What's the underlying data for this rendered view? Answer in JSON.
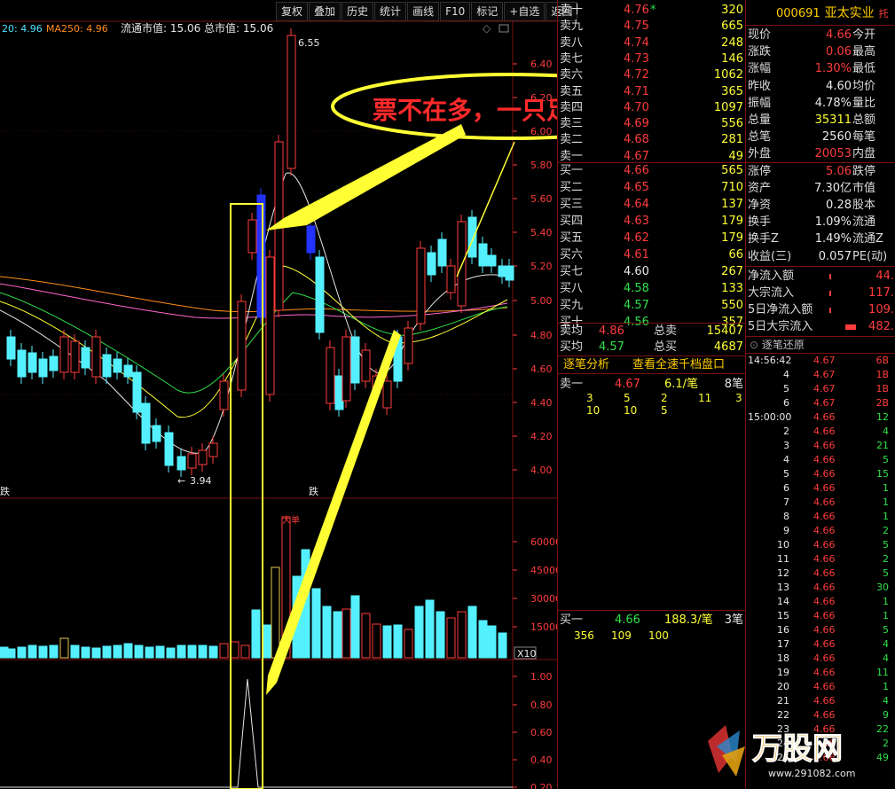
{
  "toolbar": {
    "buttons": [
      "复权",
      "叠加",
      "历史",
      "统计",
      "画线",
      "F10",
      "标记",
      "+自选",
      "返回"
    ]
  },
  "chart": {
    "ma_info": [
      {
        "text": "20: 4.96",
        "color": "#4fe2ff"
      },
      {
        "text": "MA250: 4.96",
        "color": "#ff8c1a"
      }
    ],
    "market_cap": "流通市值: 15.06 总市值: 15.06",
    "high_label": "6.55",
    "low_label": "3.94",
    "die_label_1": "跌",
    "die_label_2": "跌",
    "vol_marker": "大单",
    "annotation": "票不在多，一只足矣!",
    "price_axis": [
      "6.40",
      "6.20",
      "6.00",
      "5.80",
      "5.60",
      "5.40",
      "5.20",
      "5.00",
      "4.80",
      "4.60",
      "4.40",
      "4.20",
      "4.00"
    ],
    "vol_axis": [
      "60000",
      "45000",
      "30000",
      "15000"
    ],
    "vol_unit": "X10",
    "ind_axis": [
      "1.00",
      "0.80",
      "0.60",
      "0.40",
      "0.20"
    ]
  },
  "quote": {
    "sell": [
      {
        "name": "卖十",
        "price": "4.76",
        "vol": "320",
        "color": "#ff3c3c",
        "flag": "*"
      },
      {
        "name": "卖九",
        "price": "4.75",
        "vol": "665",
        "color": "#ff3c3c",
        "flag": ""
      },
      {
        "name": "卖八",
        "price": "4.74",
        "vol": "248",
        "color": "#ff3c3c",
        "flag": ""
      },
      {
        "name": "卖七",
        "price": "4.73",
        "vol": "146",
        "color": "#ff3c3c",
        "flag": ""
      },
      {
        "name": "卖六",
        "price": "4.72",
        "vol": "1062",
        "color": "#ff3c3c",
        "flag": ""
      },
      {
        "name": "卖五",
        "price": "4.71",
        "vol": "365",
        "color": "#ff3c3c",
        "flag": ""
      },
      {
        "name": "卖四",
        "price": "4.70",
        "vol": "1097",
        "color": "#ff3c3c",
        "flag": ""
      },
      {
        "name": "卖三",
        "price": "4.69",
        "vol": "556",
        "color": "#ff3c3c",
        "flag": ""
      },
      {
        "name": "卖二",
        "price": "4.68",
        "vol": "281",
        "color": "#ff3c3c",
        "flag": ""
      },
      {
        "name": "卖一",
        "price": "4.67",
        "vol": "49",
        "color": "#ff3c3c",
        "flag": ""
      }
    ],
    "buy": [
      {
        "name": "买一",
        "price": "4.66",
        "vol": "565",
        "color": "#ff3c3c"
      },
      {
        "name": "买二",
        "price": "4.65",
        "vol": "710",
        "color": "#ff3c3c"
      },
      {
        "name": "买三",
        "price": "4.64",
        "vol": "137",
        "color": "#ff3c3c"
      },
      {
        "name": "买四",
        "price": "4.63",
        "vol": "179",
        "color": "#ff3c3c"
      },
      {
        "name": "买五",
        "price": "4.62",
        "vol": "179",
        "color": "#ff3c3c"
      },
      {
        "name": "买六",
        "price": "4.61",
        "vol": "66",
        "color": "#ff3c3c"
      },
      {
        "name": "买七",
        "price": "4.60",
        "vol": "267",
        "color": "#e8e8e8"
      },
      {
        "name": "买八",
        "price": "4.58",
        "vol": "133",
        "color": "#2fe04a"
      },
      {
        "name": "买九",
        "price": "4.57",
        "vol": "550",
        "color": "#2fe04a"
      },
      {
        "name": "买十",
        "price": "4.56",
        "vol": "357",
        "color": "#2fe04a"
      }
    ],
    "avg_sell_label": "卖均",
    "avg_sell": "4.86",
    "total_sell_label": "总卖",
    "total_sell": "15407",
    "avg_buy_label": "买均",
    "avg_buy": "4.57",
    "total_buy_label": "总买",
    "total_buy": "4687",
    "tab_analysis": "逐笔分析",
    "tab_all": "查看全速千档盘口",
    "sell1": {
      "label": "卖一",
      "price": "4.67",
      "size": "6.1/笔",
      "count": "8笔",
      "orders": [
        [
          "3",
          "5",
          "2",
          "11",
          "3"
        ],
        [
          "10",
          "10",
          "5",
          "",
          ""
        ]
      ]
    },
    "buy1": {
      "label": "买一",
      "price": "4.66",
      "size": "188.3/笔",
      "count": "3笔",
      "orders": [
        [
          "356",
          "109",
          "100"
        ]
      ]
    }
  },
  "stock": {
    "code": "000691",
    "name": "亚太实业",
    "tag": "托",
    "stats": [
      [
        "现价",
        "4.66",
        "#ff3c3c",
        "今开",
        ""
      ],
      [
        "涨跌",
        "0.06",
        "#ff3c3c",
        "最高",
        ""
      ],
      [
        "涨幅",
        "1.30%",
        "#ff3c3c",
        "最低",
        ""
      ],
      [
        "昨收",
        "4.60",
        "#e8e8e8",
        "均价",
        ""
      ],
      [
        "振幅",
        "4.78%",
        "#e8e8e8",
        "量比",
        ""
      ],
      [
        "总量",
        "35311",
        "#ffff33",
        "总额",
        ""
      ],
      [
        "总笔",
        "2560",
        "#e8e8e8",
        "每笔",
        ""
      ],
      [
        "外盘",
        "20053",
        "#ff3c3c",
        "内盘",
        ""
      ],
      [
        "涨停",
        "5.06",
        "#ff3c3c",
        "跌停",
        ""
      ],
      [
        "资产",
        "7.30亿",
        "#e8e8e8",
        "市值",
        ""
      ],
      [
        "净资",
        "0.28",
        "#e8e8e8",
        "股本",
        ""
      ],
      [
        "换手",
        "1.09%",
        "#e8e8e8",
        "流通",
        ""
      ],
      [
        "换手Z",
        "1.49%",
        "#e8e8e8",
        "流通Z",
        ""
      ],
      [
        "收益(三)",
        "0.057",
        "#e8e8e8",
        "PE(动)",
        ""
      ]
    ],
    "flows": [
      {
        "label": "净流入额",
        "value": "44."
      },
      {
        "label": "大宗流入",
        "value": "117."
      },
      {
        "label": "5日净流入额",
        "value": "109."
      },
      {
        "label": "5日大宗流入",
        "value": "482."
      }
    ],
    "ticks_title": "逐笔还原",
    "ticks": [
      [
        "14:56:42",
        "4.67",
        "6B",
        "#ff3c3c"
      ],
      [
        "4",
        "4.67",
        "1B",
        "#ff3c3c"
      ],
      [
        "5",
        "4.67",
        "1B",
        "#ff3c3c"
      ],
      [
        "6",
        "4.67",
        "2B",
        "#ff3c3c"
      ],
      [
        "15:00:00",
        "4.66",
        "12",
        "#2fe04a"
      ],
      [
        "2",
        "4.66",
        "4",
        "#2fe04a"
      ],
      [
        "3",
        "4.66",
        "21",
        "#2fe04a"
      ],
      [
        "4",
        "4.66",
        "5",
        "#2fe04a"
      ],
      [
        "5",
        "4.66",
        "15",
        "#2fe04a"
      ],
      [
        "6",
        "4.66",
        "1",
        "#2fe04a"
      ],
      [
        "7",
        "4.66",
        "1",
        "#2fe04a"
      ],
      [
        "8",
        "4.66",
        "1",
        "#2fe04a"
      ],
      [
        "9",
        "4.66",
        "2",
        "#2fe04a"
      ],
      [
        "10",
        "4.66",
        "5",
        "#2fe04a"
      ],
      [
        "11",
        "4.66",
        "2",
        "#2fe04a"
      ],
      [
        "12",
        "4.66",
        "5",
        "#2fe04a"
      ],
      [
        "13",
        "4.66",
        "30",
        "#2fe04a"
      ],
      [
        "14",
        "4.66",
        "1",
        "#2fe04a"
      ],
      [
        "15",
        "4.66",
        "1",
        "#2fe04a"
      ],
      [
        "16",
        "4.66",
        "5",
        "#2fe04a"
      ],
      [
        "17",
        "4.66",
        "4",
        "#2fe04a"
      ],
      [
        "18",
        "4.66",
        "4",
        "#2fe04a"
      ],
      [
        "19",
        "4.66",
        "11",
        "#2fe04a"
      ],
      [
        "20",
        "4.66",
        "1",
        "#2fe04a"
      ],
      [
        "21",
        "4.66",
        "4",
        "#2fe04a"
      ],
      [
        "22",
        "4.66",
        "9",
        "#2fe04a"
      ],
      [
        "23",
        "4.66",
        "22",
        "#2fe04a"
      ],
      [
        "24",
        "4.66",
        "2",
        "#2fe04a"
      ],
      [
        "25",
        "4.66",
        "49",
        "#2fe04a"
      ]
    ]
  },
  "watermark": {
    "brand": "万股网",
    "url": "www.291082.com"
  }
}
